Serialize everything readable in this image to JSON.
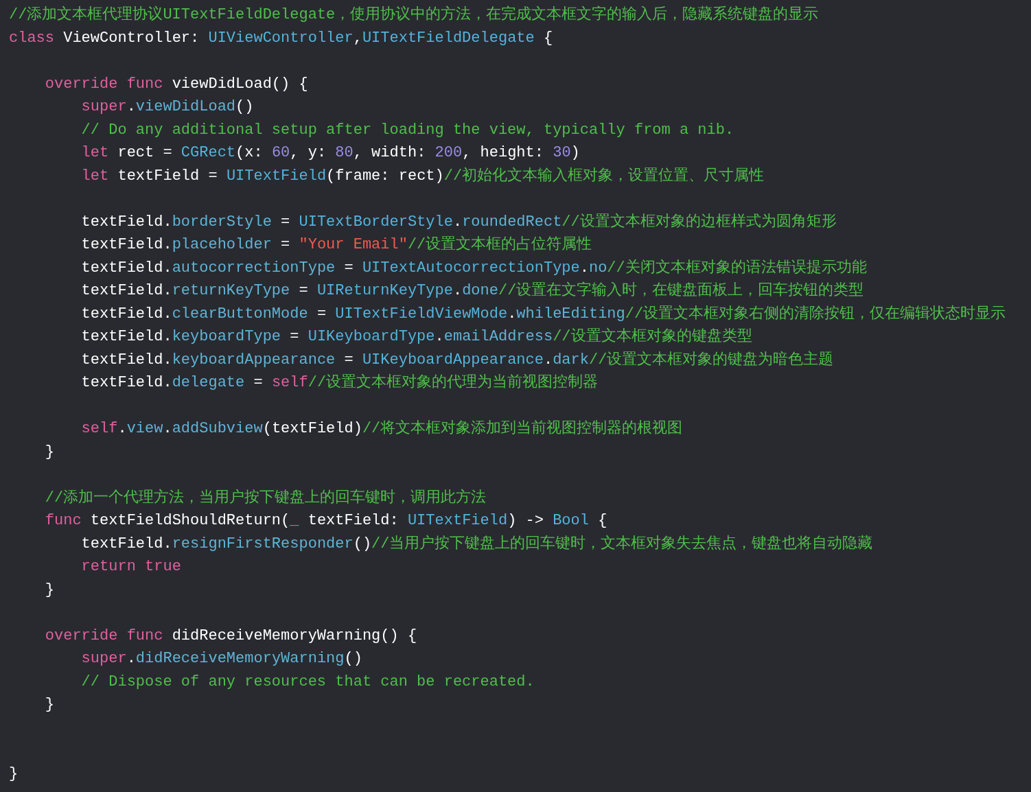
{
  "editor": {
    "lines": [
      {
        "kind": "code",
        "tokens": [
          {
            "kind": "comment",
            "text": "//添加文本框代理协议UITextFieldDelegate，使用协议中的方法，在完成文本框文字的输入后，隐藏系统键盘的显示"
          }
        ]
      },
      {
        "kind": "code",
        "tokens": [
          {
            "kind": "kw",
            "text": "class"
          },
          {
            "kind": "plain",
            "text": " ViewController: "
          },
          {
            "kind": "type",
            "text": "UIViewController"
          },
          {
            "kind": "plain",
            "text": ","
          },
          {
            "kind": "type",
            "text": "UITextFieldDelegate"
          },
          {
            "kind": "plain",
            "text": " {"
          }
        ]
      },
      {
        "kind": "blank"
      },
      {
        "kind": "code",
        "tokens": [
          {
            "kind": "kw",
            "text": "    override func"
          },
          {
            "kind": "plain",
            "text": " viewDidLoad() {"
          }
        ]
      },
      {
        "kind": "code",
        "tokens": [
          {
            "kind": "kw",
            "text": "        super"
          },
          {
            "kind": "plain",
            "text": "."
          },
          {
            "kind": "member",
            "text": "viewDidLoad"
          },
          {
            "kind": "plain",
            "text": "()"
          }
        ]
      },
      {
        "kind": "code",
        "tokens": [
          {
            "kind": "comment",
            "text": "        // Do any additional setup after loading the view, typically from a nib."
          }
        ]
      },
      {
        "kind": "code",
        "tokens": [
          {
            "kind": "kw",
            "text": "        let"
          },
          {
            "kind": "plain",
            "text": " rect = "
          },
          {
            "kind": "type",
            "text": "CGRect"
          },
          {
            "kind": "plain",
            "text": "(x: "
          },
          {
            "kind": "number",
            "text": "60"
          },
          {
            "kind": "plain",
            "text": ", y: "
          },
          {
            "kind": "number",
            "text": "80"
          },
          {
            "kind": "plain",
            "text": ", width: "
          },
          {
            "kind": "number",
            "text": "200"
          },
          {
            "kind": "plain",
            "text": ", height: "
          },
          {
            "kind": "number",
            "text": "30"
          },
          {
            "kind": "plain",
            "text": ")"
          }
        ]
      },
      {
        "kind": "code",
        "tokens": [
          {
            "kind": "kw",
            "text": "        let"
          },
          {
            "kind": "plain",
            "text": " textField = "
          },
          {
            "kind": "type",
            "text": "UITextField"
          },
          {
            "kind": "plain",
            "text": "(frame: rect)"
          },
          {
            "kind": "comment",
            "text": "//初始化文本输入框对象，设置位置、尺寸属性"
          }
        ]
      },
      {
        "kind": "blank"
      },
      {
        "kind": "code",
        "tokens": [
          {
            "kind": "plain",
            "text": "        textField."
          },
          {
            "kind": "member",
            "text": "borderStyle"
          },
          {
            "kind": "plain",
            "text": " = "
          },
          {
            "kind": "type",
            "text": "UITextBorderStyle"
          },
          {
            "kind": "plain",
            "text": "."
          },
          {
            "kind": "member",
            "text": "roundedRect"
          },
          {
            "kind": "comment",
            "text": "//设置文本框对象的边框样式为圆角矩形"
          }
        ]
      },
      {
        "kind": "code",
        "tokens": [
          {
            "kind": "plain",
            "text": "        textField."
          },
          {
            "kind": "member",
            "text": "placeholder"
          },
          {
            "kind": "plain",
            "text": " = "
          },
          {
            "kind": "string",
            "text": "\"Your Email\""
          },
          {
            "kind": "comment",
            "text": "//设置文本框的占位符属性"
          }
        ]
      },
      {
        "kind": "code",
        "tokens": [
          {
            "kind": "plain",
            "text": "        textField."
          },
          {
            "kind": "member",
            "text": "autocorrectionType"
          },
          {
            "kind": "plain",
            "text": " = "
          },
          {
            "kind": "type",
            "text": "UITextAutocorrectionType"
          },
          {
            "kind": "plain",
            "text": "."
          },
          {
            "kind": "member",
            "text": "no"
          },
          {
            "kind": "comment",
            "text": "//关闭文本框对象的语法错误提示功能"
          }
        ]
      },
      {
        "kind": "code",
        "tokens": [
          {
            "kind": "plain",
            "text": "        textField."
          },
          {
            "kind": "member",
            "text": "returnKeyType"
          },
          {
            "kind": "plain",
            "text": " = "
          },
          {
            "kind": "type",
            "text": "UIReturnKeyType"
          },
          {
            "kind": "plain",
            "text": "."
          },
          {
            "kind": "member",
            "text": "done"
          },
          {
            "kind": "comment",
            "text": "//设置在文字输入时，在键盘面板上，回车按钮的类型"
          }
        ]
      },
      {
        "kind": "code",
        "tokens": [
          {
            "kind": "plain",
            "text": "        textField."
          },
          {
            "kind": "member",
            "text": "clearButtonMode"
          },
          {
            "kind": "plain",
            "text": " = "
          },
          {
            "kind": "type",
            "text": "UITextFieldViewMode"
          },
          {
            "kind": "plain",
            "text": "."
          },
          {
            "kind": "member",
            "text": "whileEditing"
          },
          {
            "kind": "comment",
            "text": "//设置文本框对象右侧的清除按钮，仅在编辑状态时显示"
          }
        ]
      },
      {
        "kind": "code",
        "tokens": [
          {
            "kind": "plain",
            "text": "        textField."
          },
          {
            "kind": "member",
            "text": "keyboardType"
          },
          {
            "kind": "plain",
            "text": " = "
          },
          {
            "kind": "type",
            "text": "UIKeyboardType"
          },
          {
            "kind": "plain",
            "text": "."
          },
          {
            "kind": "member",
            "text": "emailAddress"
          },
          {
            "kind": "comment",
            "text": "//设置文本框对象的键盘类型"
          }
        ]
      },
      {
        "kind": "code",
        "tokens": [
          {
            "kind": "plain",
            "text": "        textField."
          },
          {
            "kind": "member",
            "text": "keyboardAppearance"
          },
          {
            "kind": "plain",
            "text": " = "
          },
          {
            "kind": "type",
            "text": "UIKeyboardAppearance"
          },
          {
            "kind": "plain",
            "text": "."
          },
          {
            "kind": "member",
            "text": "dark"
          },
          {
            "kind": "comment",
            "text": "//设置文本框对象的键盘为暗色主题"
          }
        ]
      },
      {
        "kind": "code",
        "tokens": [
          {
            "kind": "plain",
            "text": "        textField."
          },
          {
            "kind": "member",
            "text": "delegate"
          },
          {
            "kind": "plain",
            "text": " = "
          },
          {
            "kind": "kw",
            "text": "self"
          },
          {
            "kind": "comment",
            "text": "//设置文本框对象的代理为当前视图控制器"
          }
        ]
      },
      {
        "kind": "blank"
      },
      {
        "kind": "code",
        "tokens": [
          {
            "kind": "kw",
            "text": "        self"
          },
          {
            "kind": "plain",
            "text": "."
          },
          {
            "kind": "member",
            "text": "view"
          },
          {
            "kind": "plain",
            "text": "."
          },
          {
            "kind": "member",
            "text": "addSubview"
          },
          {
            "kind": "plain",
            "text": "(textField)"
          },
          {
            "kind": "comment",
            "text": "//将文本框对象添加到当前视图控制器的根视图"
          }
        ]
      },
      {
        "kind": "code",
        "tokens": [
          {
            "kind": "plain",
            "text": "    }"
          }
        ]
      },
      {
        "kind": "blank"
      },
      {
        "kind": "code",
        "tokens": [
          {
            "kind": "comment",
            "text": "    //添加一个代理方法，当用户按下键盘上的回车键时，调用此方法"
          }
        ]
      },
      {
        "kind": "code",
        "tokens": [
          {
            "kind": "kw",
            "text": "    func"
          },
          {
            "kind": "plain",
            "text": " textFieldShouldReturn("
          },
          {
            "kind": "kw",
            "text": "_"
          },
          {
            "kind": "plain",
            "text": " textField: "
          },
          {
            "kind": "type",
            "text": "UITextField"
          },
          {
            "kind": "plain",
            "text": ") -> "
          },
          {
            "kind": "type",
            "text": "Bool"
          },
          {
            "kind": "plain",
            "text": " {"
          }
        ]
      },
      {
        "kind": "code",
        "tokens": [
          {
            "kind": "plain",
            "text": "        textField."
          },
          {
            "kind": "member",
            "text": "resignFirstResponder"
          },
          {
            "kind": "plain",
            "text": "()"
          },
          {
            "kind": "comment",
            "text": "//当用户按下键盘上的回车键时，文本框对象失去焦点，键盘也将自动隐藏"
          }
        ]
      },
      {
        "kind": "code",
        "tokens": [
          {
            "kind": "kw",
            "text": "        return true"
          }
        ]
      },
      {
        "kind": "code",
        "tokens": [
          {
            "kind": "plain",
            "text": "    }"
          }
        ]
      },
      {
        "kind": "blank"
      },
      {
        "kind": "code",
        "tokens": [
          {
            "kind": "kw",
            "text": "    override func"
          },
          {
            "kind": "plain",
            "text": " didReceiveMemoryWarning() {"
          }
        ]
      },
      {
        "kind": "code",
        "tokens": [
          {
            "kind": "kw",
            "text": "        super"
          },
          {
            "kind": "plain",
            "text": "."
          },
          {
            "kind": "member",
            "text": "didReceiveMemoryWarning"
          },
          {
            "kind": "plain",
            "text": "()"
          }
        ]
      },
      {
        "kind": "code",
        "tokens": [
          {
            "kind": "comment",
            "text": "        // Dispose of any resources that can be recreated."
          }
        ]
      },
      {
        "kind": "code",
        "tokens": [
          {
            "kind": "plain",
            "text": "    }"
          }
        ]
      },
      {
        "kind": "blank"
      },
      {
        "kind": "blank"
      },
      {
        "kind": "code",
        "tokens": [
          {
            "kind": "plain",
            "text": "}"
          }
        ]
      }
    ]
  }
}
